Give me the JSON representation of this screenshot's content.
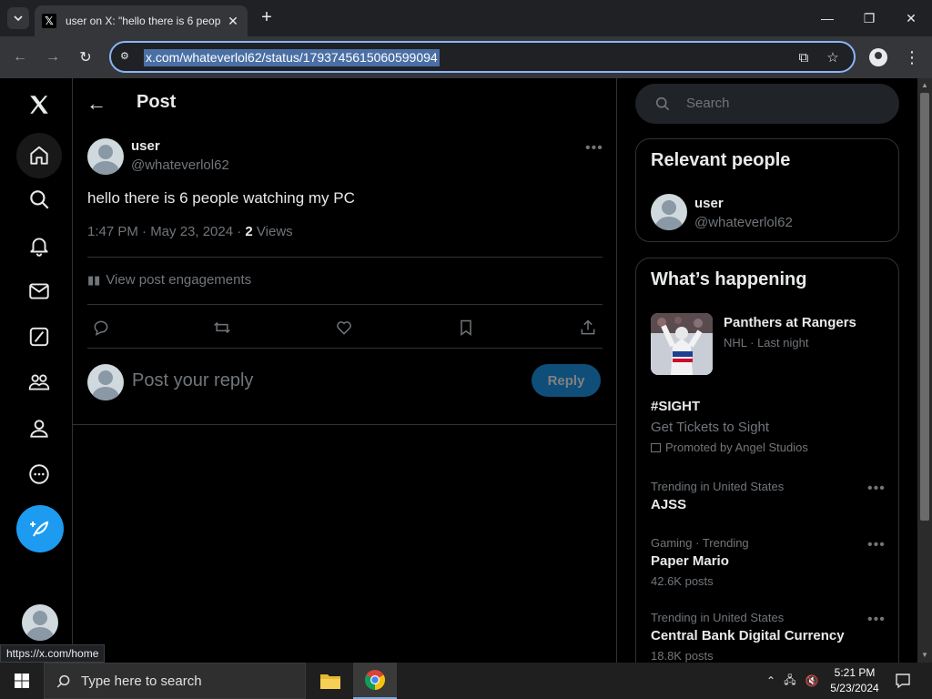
{
  "browser": {
    "tab_title": "user on X: \"hello there is 6 peop",
    "url": "x.com/whateverlol62/status/1793745615060599094",
    "status_url": "https://x.com/home"
  },
  "header": {
    "title": "Post"
  },
  "post": {
    "author_name": "user",
    "author_handle": "@whateverlol62",
    "text": "hello there is 6 people watching my PC",
    "meta_time": "1:47 PM · May 23, 2024 · ",
    "views_count": "2",
    "views_label": " Views",
    "engagements_label": "View post engagements",
    "reply_placeholder": "Post your reply",
    "reply_button": "Reply"
  },
  "search": {
    "placeholder": "Search"
  },
  "relevant_people": {
    "title": "Relevant people",
    "name": "user",
    "handle": "@whateverlol62"
  },
  "whats_happening": {
    "title": "What’s happening",
    "featured": {
      "title": "Panthers at Rangers",
      "meta": "NHL · Last night"
    },
    "promo": {
      "title": "#SIGHT",
      "subtitle": "Get Tickets to Sight",
      "promoted": "Promoted by Angel Studios"
    },
    "trends": [
      {
        "context": "Trending in United States",
        "title": "AJSS",
        "posts": ""
      },
      {
        "context": "Gaming · Trending",
        "title": "Paper Mario",
        "posts": "42.6K posts"
      },
      {
        "context": "Trending in United States",
        "title": "Central Bank Digital Currency",
        "posts": "18.8K posts"
      }
    ]
  },
  "taskbar": {
    "search_placeholder": "Type here to search",
    "time": "5:21 PM",
    "date": "5/23/2024"
  },
  "colors": {
    "accent": "#1d9bf0",
    "bg": "#000000",
    "muted": "#71767b"
  }
}
